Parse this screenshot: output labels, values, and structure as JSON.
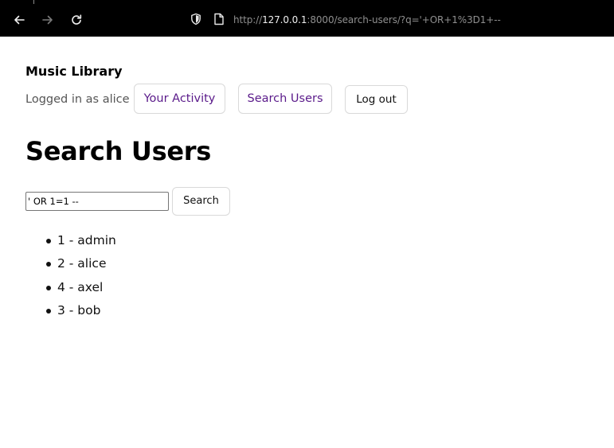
{
  "browser": {
    "url_prefix": "http://",
    "url_host": "127.0.0.1",
    "url_rest": ":8000/search-users/?q='+OR+1%3D1+--"
  },
  "header": {
    "site_title": "Music Library",
    "logged_in_text": "Logged in as alice",
    "nav": {
      "activity_label": "Your Activity",
      "search_users_label": "Search Users",
      "logout_label": "Log out"
    }
  },
  "main": {
    "title": "Search Users",
    "search": {
      "value": "' OR 1=1 --",
      "button_label": "Search"
    },
    "results": [
      "1 - admin",
      "2 - alice",
      "4 - axel",
      "3 - bob"
    ]
  }
}
